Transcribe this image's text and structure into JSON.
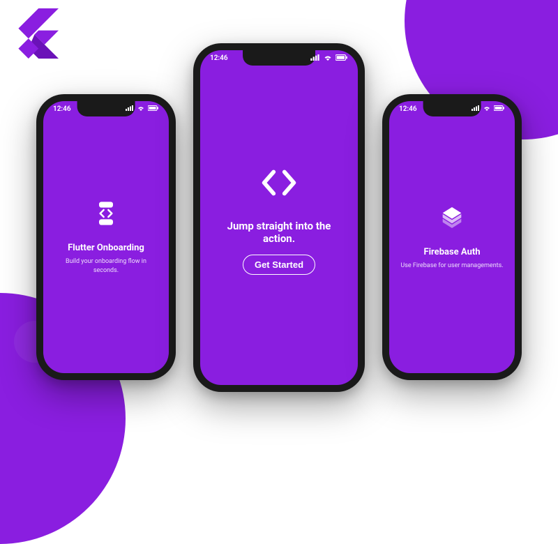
{
  "statusbar": {
    "time": "12:46"
  },
  "screens": {
    "left": {
      "title": "Flutter Onboarding",
      "subtitle": "Build your onboarding flow in seconds."
    },
    "center": {
      "title": "Jump straight into the action.",
      "cta_label": "Get Started"
    },
    "right": {
      "title": "Firebase Auth",
      "subtitle": "Use Firebase for user managements."
    }
  },
  "colors": {
    "brand": "#8a1ee0"
  }
}
